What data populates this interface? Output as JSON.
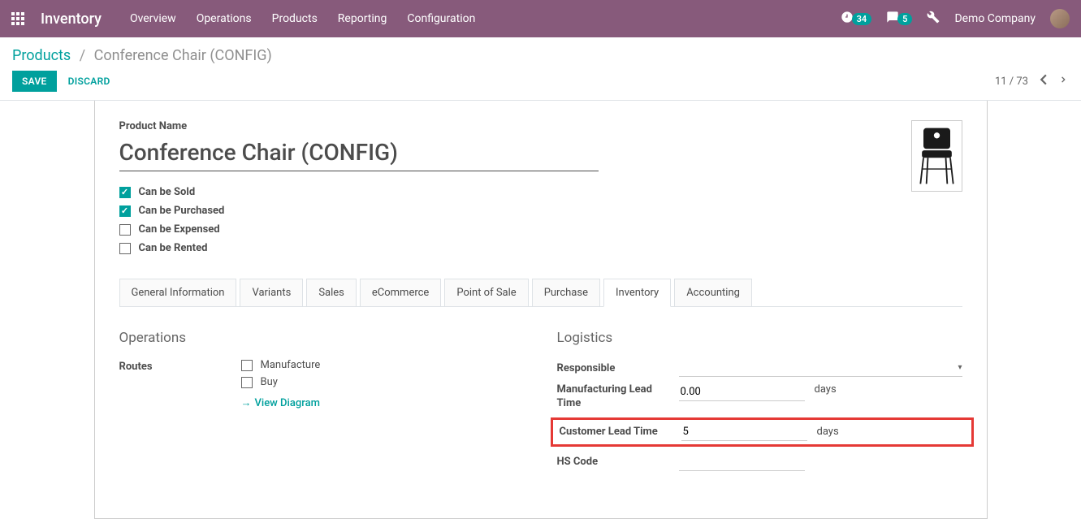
{
  "navbar": {
    "brand": "Inventory",
    "menu": [
      "Overview",
      "Operations",
      "Products",
      "Reporting",
      "Configuration"
    ],
    "notif_count": "34",
    "msg_count": "5",
    "company": "Demo Company"
  },
  "breadcrumb": {
    "root": "Products",
    "current": "Conference Chair (CONFIG)"
  },
  "actions": {
    "save": "SAVE",
    "discard": "DISCARD",
    "pager": "11 / 73"
  },
  "form": {
    "product_name_label": "Product Name",
    "product_name": "Conference Chair (CONFIG)",
    "checks": {
      "can_be_sold": "Can be Sold",
      "can_be_purchased": "Can be Purchased",
      "can_be_expensed": "Can be Expensed",
      "can_be_rented": "Can be Rented"
    }
  },
  "tabs": [
    "General Information",
    "Variants",
    "Sales",
    "eCommerce",
    "Point of Sale",
    "Purchase",
    "Inventory",
    "Accounting"
  ],
  "operations": {
    "title": "Operations",
    "routes_label": "Routes",
    "manufacture": "Manufacture",
    "buy": "Buy",
    "view_diagram": "View Diagram"
  },
  "logistics": {
    "title": "Logistics",
    "responsible_label": "Responsible",
    "mfg_lead_label": "Manufacturing Lead Time",
    "mfg_lead_value": "0.00",
    "days": "days",
    "cust_lead_label": "Customer Lead Time",
    "cust_lead_value": "5",
    "hs_label": "HS Code"
  }
}
